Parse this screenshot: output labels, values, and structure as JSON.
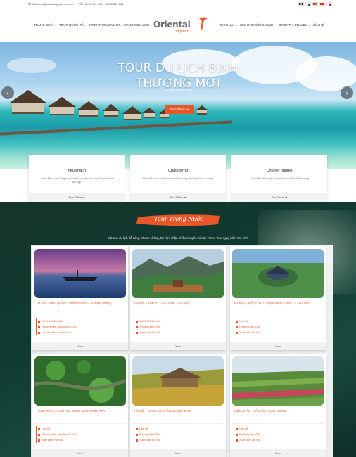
{
  "topbar": {
    "email": "Mail: info@orientimpress.com.vn",
    "phone": "0943 429 0999 - 0983 362 508",
    "languages": [
      "en-flag-icon",
      "kr-flag-icon",
      "vn-flag-icon",
      "cn-flag-icon",
      "jp-flag-icon"
    ]
  },
  "nav": {
    "items_left": [
      {
        "label": "TRANG CHỦ"
      },
      {
        "label": "TOUR QUỐC TẾ"
      },
      {
        "label": "TOUR TRONG NƯỚC"
      },
      {
        "label": "COMBO DU LỊCH"
      }
    ],
    "items_right": [
      {
        "label": "DỊCH VỤ"
      },
      {
        "label": "KINH NGHIỆM DU LỊCH"
      },
      {
        "label": "ORIENTAL TRAVEL"
      },
      {
        "label": "LIÊN HỆ"
      }
    ],
    "logo": {
      "name": "Oriental",
      "tagline": "Impress"
    }
  },
  "hero": {
    "title_line1": "TOUR DU LỊCH BÌNH",
    "title_line2": "THƯỜNG MỚI",
    "subtitle": "An toàn và tiết kiệm",
    "button": "Xem Thêm ➜"
  },
  "features": [
    {
      "title": "Yêu khách",
      "desc": "Luôn đặt sự hài lòng của khách làm tiêu chuẩn phát triển của đội ngũ",
      "more": "Đọc Thêm ➜"
    },
    {
      "title": "Chất lượng",
      "desc": "Đảm bảo mọi sự lựa chọn chất lượng cho từng khách hàng",
      "more": "Đọc Thêm ➜"
    },
    {
      "title": "Chuyên nghiệp",
      "desc": "Luôn tiếp nhận góp ý và phản hồi của khách hàng",
      "more": "Đọc Thêm ➜"
    }
  ],
  "domestic": {
    "badge": "Tour Trong Nước",
    "intro": "Đặt tour du lịch dễ dàng, nhanh chóng, tiện lợi, nhận nhiều khuyến mãi tại Travel Tour ngay hôm nay nhé!",
    "view_label": "Xem",
    "tours": [
      {
        "title": "HÀ NỘI – PHÚ QUỐC – VINWONDER – SAFARI (4N3Đ)",
        "rows": [
          "5.990.000đ/khách",
          "Phương tiện: Máy bay & Ô tô",
          "Lưu trú: Khách sạn 4 sao"
        ]
      },
      {
        "title": "HÀ NỘI – YÊN TỬ – BA VÀNG – HÀ NỘI",
        "rows": [
          "1.055.000đ/khách",
          "Phương tiện: Ô tô",
          "Xuất phát: Hà Nội"
        ]
      },
      {
        "title": "HÀ NỘI – MỘC CHÂU – ĐIỆN BIÊN – SƠN LA – HÀ NỘI",
        "rows": [
          "Liên hệ",
          "Phương tiện: Ô tô",
          "Xuất phát: Hà Nội"
        ]
      },
      {
        "title": "HÀNH TRÌNH KHÁM PHÁ SÔNG NƯỚC MIỀN TÂY",
        "rows": [
          "Liên hệ",
          "Phương tiện: Máy bay & Ô tô",
          "Xuất phát: Hà Nội"
        ]
      },
      {
        "title": "HÀ NỘI – MÙ CANG CHẢI MÙA LÚA CHÍN",
        "rows": [
          "Liên hệ",
          "Phương tiện: Ô tô",
          "Xuất phát: Hà Nội"
        ]
      },
      {
        "title": "MỘC CHÂU – CẦU KÍNH BẠCH LONG",
        "rows": [
          "Liên hệ",
          "Phương tiện: Ô tô",
          "Xuất phát: Hà Nội"
        ]
      }
    ]
  },
  "colors": {
    "accent": "#e8562a",
    "section_bg": "#15352a"
  }
}
